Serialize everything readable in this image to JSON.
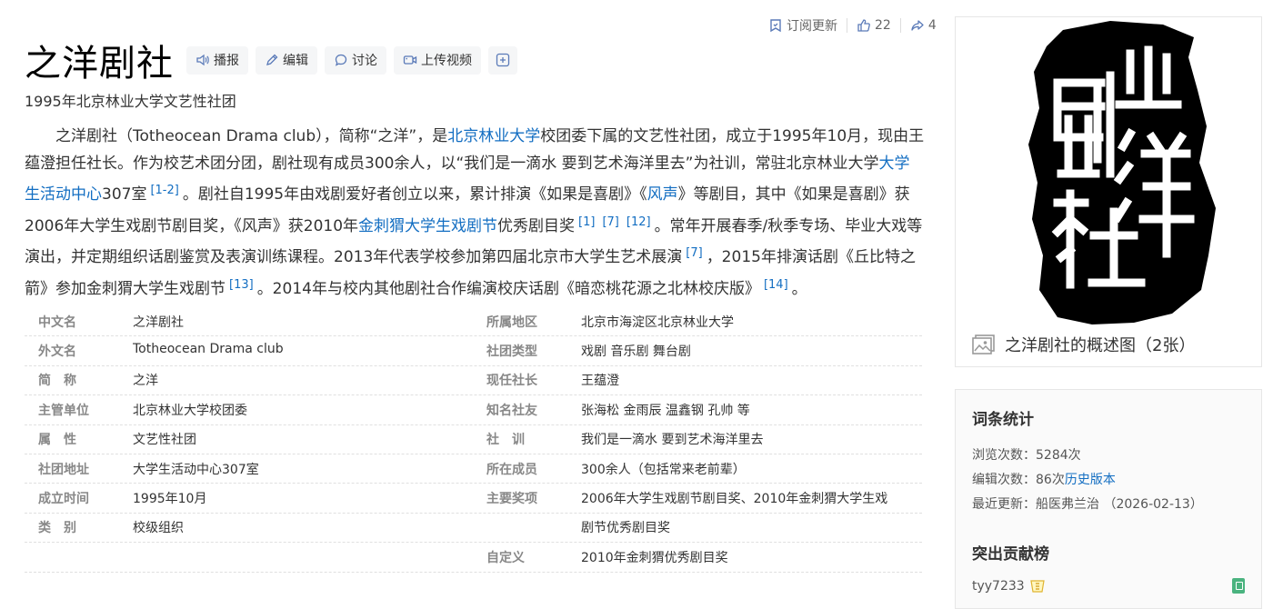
{
  "actions": {
    "subscribe": "订阅更新",
    "likes": "22",
    "shares": "4"
  },
  "title": "之洋剧社",
  "toolbar": {
    "broadcast": "播报",
    "edit": "编辑",
    "discuss": "讨论",
    "upload_video": "上传视频"
  },
  "subtitle": "1995年北京林业大学文艺性社团",
  "summary": {
    "p1": "之洋剧社（Totheocean Drama club），简称“之洋”，是",
    "link_bjfu": "北京林业大学",
    "p2": "校团委下属的文艺性社团，成立于1995年10月，现由王蕴澄担任社长。作为校艺术团分团，剧社现有成员300余人，以“我们是一滴水 要到艺术海洋里去”为社训，常驻北京林业大学",
    "link_center": "大学生活动中心",
    "p3": "307室",
    "ref1": "[1-2]",
    "p4": "。剧社自1995年由戏剧爱好者创立以来，累计排演《如果是喜剧》《",
    "link_fengsheng": "风声",
    "p5": "》等剧目，其中《如果是喜剧》获2006年大学生戏剧节剧目奖，《风声》获2010年",
    "link_festival": "金刺猬大学生戏剧节",
    "p6": "优秀剧目奖",
    "ref2": "[1]",
    "ref3": "[7]",
    "ref4": "[12]",
    "p7": "。常年开展春季/秋季专场、毕业大戏等演出，并定期组织话剧鉴赏及表演训练课程。2013年代表学校参加第四届北京市大学生艺术展演",
    "ref5": "[7]",
    "p8": "，2015年排演话剧《丘比特之箭》参加金刺猬大学生戏剧节",
    "ref6": "[13]",
    "p9": "。2014年与校内其他剧社合作编演校庆话剧《暗恋桃花源之北林校庆版》",
    "ref7": "[14]",
    "p10": "。"
  },
  "basic_info": {
    "left": [
      {
        "name": "中文名",
        "value": "之洋剧社"
      },
      {
        "name": "外文名",
        "value": "Totheocean Drama club"
      },
      {
        "name": "简　称",
        "value": "之洋"
      },
      {
        "name": "主管单位",
        "value": "北京林业大学校团委"
      },
      {
        "name": "属　性",
        "value": "文艺性社团"
      },
      {
        "name": "社团地址",
        "value": "大学生活动中心307室"
      },
      {
        "name": "成立时间",
        "value": "1995年10月"
      },
      {
        "name": "类　别",
        "value": "校级组织"
      },
      {
        "name": "",
        "value": ""
      }
    ],
    "right": [
      {
        "name": "所属地区",
        "value": "北京市海淀区北京林业大学"
      },
      {
        "name": "社团类型",
        "value": "戏剧 音乐剧 舞台剧"
      },
      {
        "name": "现任社长",
        "value": "王蕴澄"
      },
      {
        "name": "知名社友",
        "value": "张海松 金雨辰 温鑫钢 孔帅 等"
      },
      {
        "name": "社　训",
        "value": "我们是一滴水 要到艺术海洋里去"
      },
      {
        "name": "所在成员",
        "value": "300余人（包括常来老前辈）"
      },
      {
        "name": "主要奖项",
        "value": "2006年大学生戏剧节剧目奖、2010年金刺猬大学生戏"
      },
      {
        "name": "",
        "value": "剧节优秀剧目奖"
      },
      {
        "name": "自定义",
        "value": "2010年金刺猬优秀剧目奖"
      }
    ]
  },
  "album": {
    "caption": "之洋剧社的概述图（2张）",
    "seal_text": "之洋剧社"
  },
  "stats": {
    "heading": "词条统计",
    "views": "浏览次数：5284次",
    "edits": "编辑次数：86次",
    "history_link": "历史版本",
    "last_update_label": "最近更新：",
    "last_update_user": "船医弗兰治",
    "last_update_date": "（2026-02-13）",
    "contrib_heading": "突出贡献榜",
    "contributor": "tyy7233"
  },
  "colors": {
    "link": "#136ec2",
    "icon_blue": "#5a7ab8",
    "seal": "#000000"
  }
}
